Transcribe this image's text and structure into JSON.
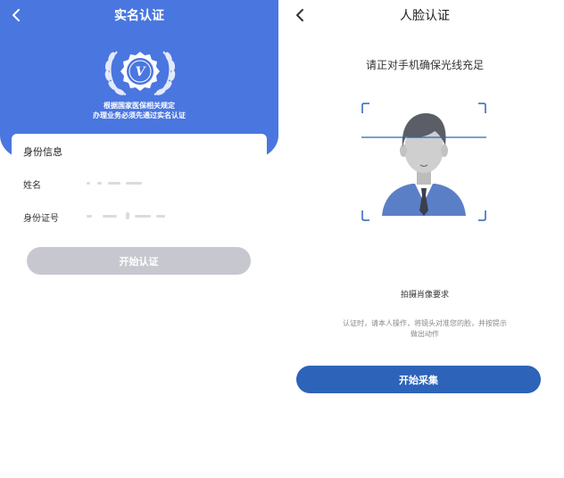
{
  "left": {
    "title": "实名认证",
    "badge_letter": "V",
    "notice_line1": "根据国家医保相关规定",
    "notice_line2": "办理业务必须先通过实名认证",
    "card": {
      "title": "身份信息",
      "name_label": "姓名",
      "id_label": "身份证号"
    },
    "start_button": "开始认证"
  },
  "right": {
    "title": "人脸认证",
    "instruction": "请正对手机确保光线充足",
    "requirements_title": "拍摄肖像要求",
    "requirements_line1": "认证时，请本人操作，将镜头对准您的脸，并按提示",
    "requirements_line2": "做出动作",
    "collect_button": "开始采集"
  },
  "colors": {
    "header_blue": "#4a76df",
    "primary_button": "#2d63b8",
    "disabled_button": "#c7c8cf"
  }
}
